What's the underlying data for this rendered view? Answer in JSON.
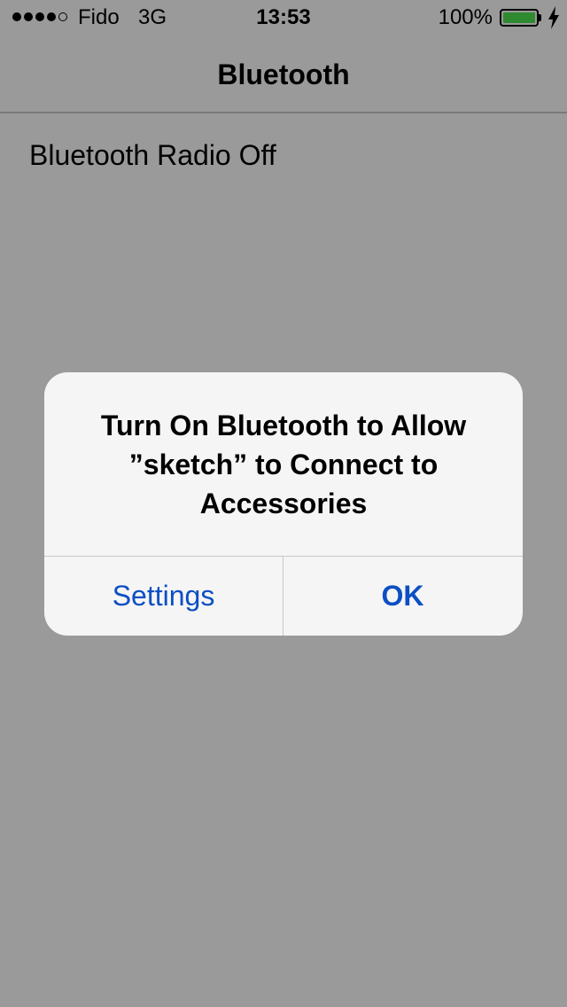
{
  "status_bar": {
    "signal_bars_filled": 4,
    "signal_bars_total": 5,
    "carrier": "Fido",
    "network": "3G",
    "time": "13:53",
    "battery_percent": "100%",
    "battery_level": 1.0,
    "charging_icon": "bolt-icon",
    "battery_color": "#2f8a2f"
  },
  "nav": {
    "title": "Bluetooth"
  },
  "content": {
    "radio_status": "Bluetooth Radio Off"
  },
  "alert": {
    "title": "Turn On Bluetooth to Allow ”sketch” to Connect to Accessories",
    "buttons": [
      {
        "label": "Settings"
      },
      {
        "label": "OK"
      }
    ],
    "accent_color": "#0c4fc4"
  }
}
